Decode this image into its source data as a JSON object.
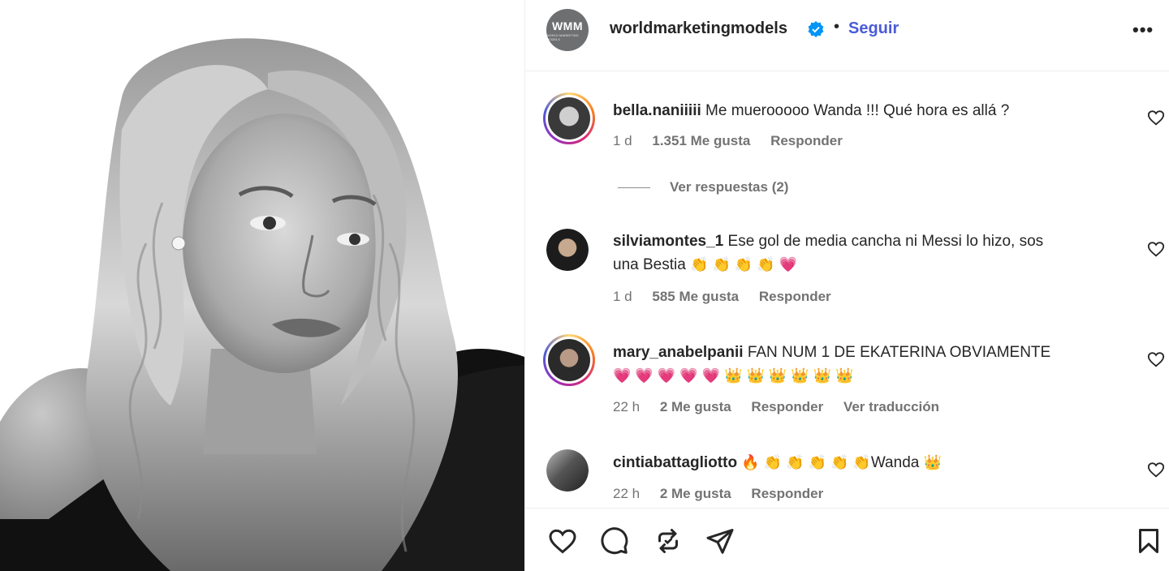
{
  "post": {
    "author": "worldmarketingmodels",
    "author_avatar_text": "WMM",
    "author_avatar_subtext": "WORLD MARKETING MODELS",
    "follow_label": "Seguir",
    "separator": "•",
    "more_label": "•••"
  },
  "comments": [
    {
      "user": "bella.naniiiii",
      "text": "Me muerooooo Wanda !!! Qué hora es allá ?",
      "time": "1 d",
      "likes": "1.351 Me gusta",
      "reply": "Responder",
      "view_replies": "Ver respuestas (2)"
    },
    {
      "user": "silviamontes_1",
      "text_line1": "Ese gol de media cancha ni Messi lo hizo, sos",
      "text_line2": "una Bestia",
      "emojis": "👏 👏 👏 👏  💗",
      "time": "1 d",
      "likes": "585 Me gusta",
      "reply": "Responder"
    },
    {
      "user": "mary_anabelpanii",
      "text": "FAN NUM 1 DE EKATERINA OBVIAMENTE",
      "emojis": "💗 💗 💗 💗 💗 👑 👑 👑 👑 👑 👑",
      "time": "22 h",
      "likes": "2 Me gusta",
      "reply": "Responder",
      "translate": "Ver traducción"
    },
    {
      "user": "cintiabattagliotto",
      "emojis_before": "🔥 👏 👏 👏 👏 👏",
      "text": "Wanda",
      "emojis_after": "👑",
      "time": "22 h",
      "likes": "2 Me gusta",
      "reply": "Responder"
    }
  ],
  "icons": {
    "like": "heart-icon",
    "comment": "comment-icon",
    "repost": "repost-icon",
    "share": "share-icon",
    "save": "bookmark-icon"
  },
  "colors": {
    "accent": "#4a5bd9",
    "verified": "#0095f6",
    "text": "#262626",
    "muted": "#737373"
  }
}
